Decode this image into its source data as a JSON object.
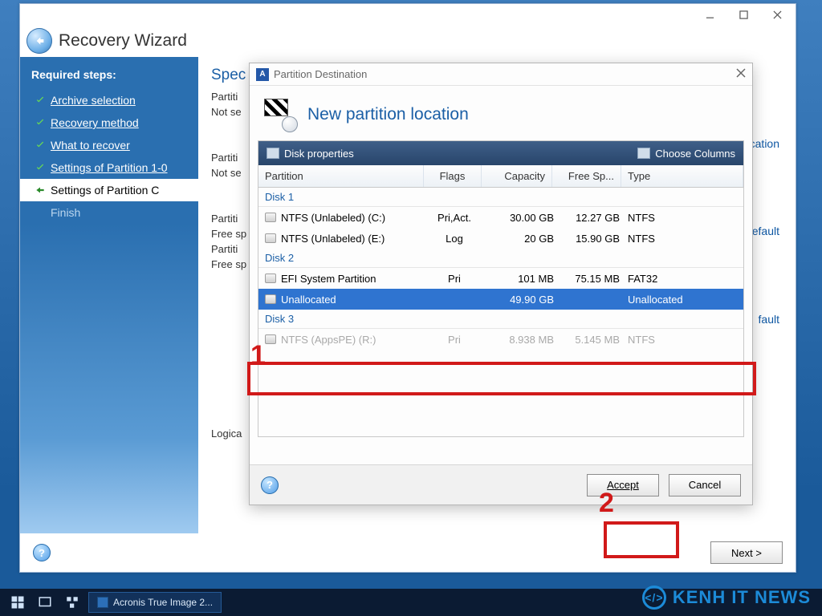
{
  "wizard": {
    "title": "Recovery Wizard",
    "sidebar_title": "Required steps:",
    "steps": [
      {
        "label": "Archive selection",
        "state": "done"
      },
      {
        "label": "Recovery method",
        "state": "done"
      },
      {
        "label": "What to recover",
        "state": "done"
      },
      {
        "label": "Settings of Partition 1-0",
        "state": "done"
      },
      {
        "label": "Settings of Partition C",
        "state": "active"
      },
      {
        "label": "Finish",
        "state": "disabled"
      }
    ],
    "main": {
      "section_title": "Spec",
      "lines": [
        "Partiti",
        "Not se",
        "Partiti",
        "Not se",
        "Partiti",
        "Free sp",
        "Partiti",
        "Free sp",
        "Logica"
      ],
      "right_links": [
        "cation",
        "efault",
        "fault"
      ]
    },
    "next_label": "Next >"
  },
  "modal": {
    "titlebar": "Partition Destination",
    "heading": "New partition location",
    "toolbar": {
      "left": "Disk properties",
      "right": "Choose Columns"
    },
    "columns": {
      "partition": "Partition",
      "flags": "Flags",
      "capacity": "Capacity",
      "free": "Free Sp...",
      "type": "Type"
    },
    "groups": [
      {
        "name": "Disk 1",
        "rows": [
          {
            "partition": "NTFS (Unlabeled) (C:)",
            "flags": "Pri,Act.",
            "capacity": "30.00 GB",
            "free": "12.27 GB",
            "type": "NTFS"
          },
          {
            "partition": "NTFS (Unlabeled) (E:)",
            "flags": "Log",
            "capacity": "20 GB",
            "free": "15.90 GB",
            "type": "NTFS"
          }
        ]
      },
      {
        "name": "Disk 2",
        "rows": [
          {
            "partition": "EFI System Partition",
            "flags": "Pri",
            "capacity": "101 MB",
            "free": "75.15 MB",
            "type": "FAT32",
            "covered": true
          },
          {
            "partition": "Unallocated",
            "flags": "",
            "capacity": "49.90 GB",
            "free": "",
            "type": "Unallocated",
            "selected": true
          }
        ]
      },
      {
        "name": "Disk 3",
        "rows": [
          {
            "partition": "NTFS (AppsPE) (R:)",
            "flags": "Pri",
            "capacity": "8.938 MB",
            "free": "5.145 MB",
            "type": "NTFS",
            "faded": true
          }
        ]
      }
    ],
    "accept": "Accept",
    "cancel": "Cancel"
  },
  "taskbar": {
    "app": "Acronis True Image 2..."
  },
  "watermark": "KENH IT NEWS",
  "annotations": {
    "1": "1",
    "2": "2"
  }
}
